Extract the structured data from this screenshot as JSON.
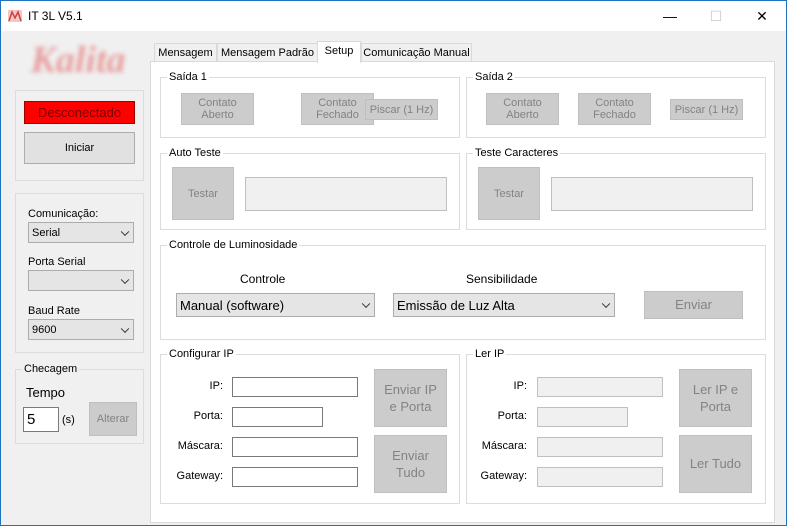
{
  "window": {
    "title": "IT 3L V5.1",
    "minimize_glyph": "—",
    "maximize_glyph": "☐",
    "close_glyph": "✕"
  },
  "left": {
    "logo_text": "Kalita",
    "status_label": "Desconectado",
    "start_button": "Iniciar",
    "comm_label": "Comunicação:",
    "comm_value": "Serial",
    "serial_port_label": "Porta Serial",
    "serial_port_value": "",
    "baud_label": "Baud Rate",
    "baud_value": "9600",
    "check_group": "Checagem",
    "time_label": "Tempo",
    "time_value": "5",
    "time_unit": "(s)",
    "change_button": "Alterar"
  },
  "tabs": [
    "Mensagem",
    "Mensagem Padrão",
    "Setup",
    "Comunicação Manual"
  ],
  "active_tab": "Setup",
  "setup": {
    "saida1": {
      "title": "Saída 1",
      "open": "Contato Aberto",
      "closed": "Contato Fechado",
      "blink": "Piscar (1 Hz)"
    },
    "saida2": {
      "title": "Saída 2",
      "open": "Contato Aberto",
      "closed": "Contato Fechado",
      "blink": "Piscar (1 Hz)"
    },
    "auto_test": {
      "title": "Auto Teste",
      "button": "Testar",
      "output": ""
    },
    "char_test": {
      "title": "Teste Caracteres",
      "button": "Testar",
      "output": ""
    },
    "brightness": {
      "title": "Controle de Luminosidade",
      "control_label": "Controle",
      "control_value": "Manual (software)",
      "sensitivity_label": "Sensibilidade",
      "sensitivity_value": "Emissão de Luz Alta",
      "send_button": "Enviar"
    },
    "config_ip": {
      "title": "Configurar IP",
      "ip_label": "IP:",
      "port_label": "Porta:",
      "mask_label": "Máscara:",
      "gateway_label": "Gateway:",
      "ip_value": "",
      "port_value": "",
      "mask_value": "",
      "gateway_value": "",
      "send_ip_port": "Enviar IP e Porta",
      "send_all": "Enviar Tudo"
    },
    "read_ip": {
      "title": "Ler IP",
      "ip_label": "IP:",
      "port_label": "Porta:",
      "mask_label": "Máscara:",
      "gateway_label": "Gateway:",
      "read_ip_port": "Ler IP e Porta",
      "read_all": "Ler Tudo"
    }
  },
  "colors": {
    "status_bg": "#ff0000",
    "status_text": "#8b0000",
    "window_border": "#1e73be"
  }
}
